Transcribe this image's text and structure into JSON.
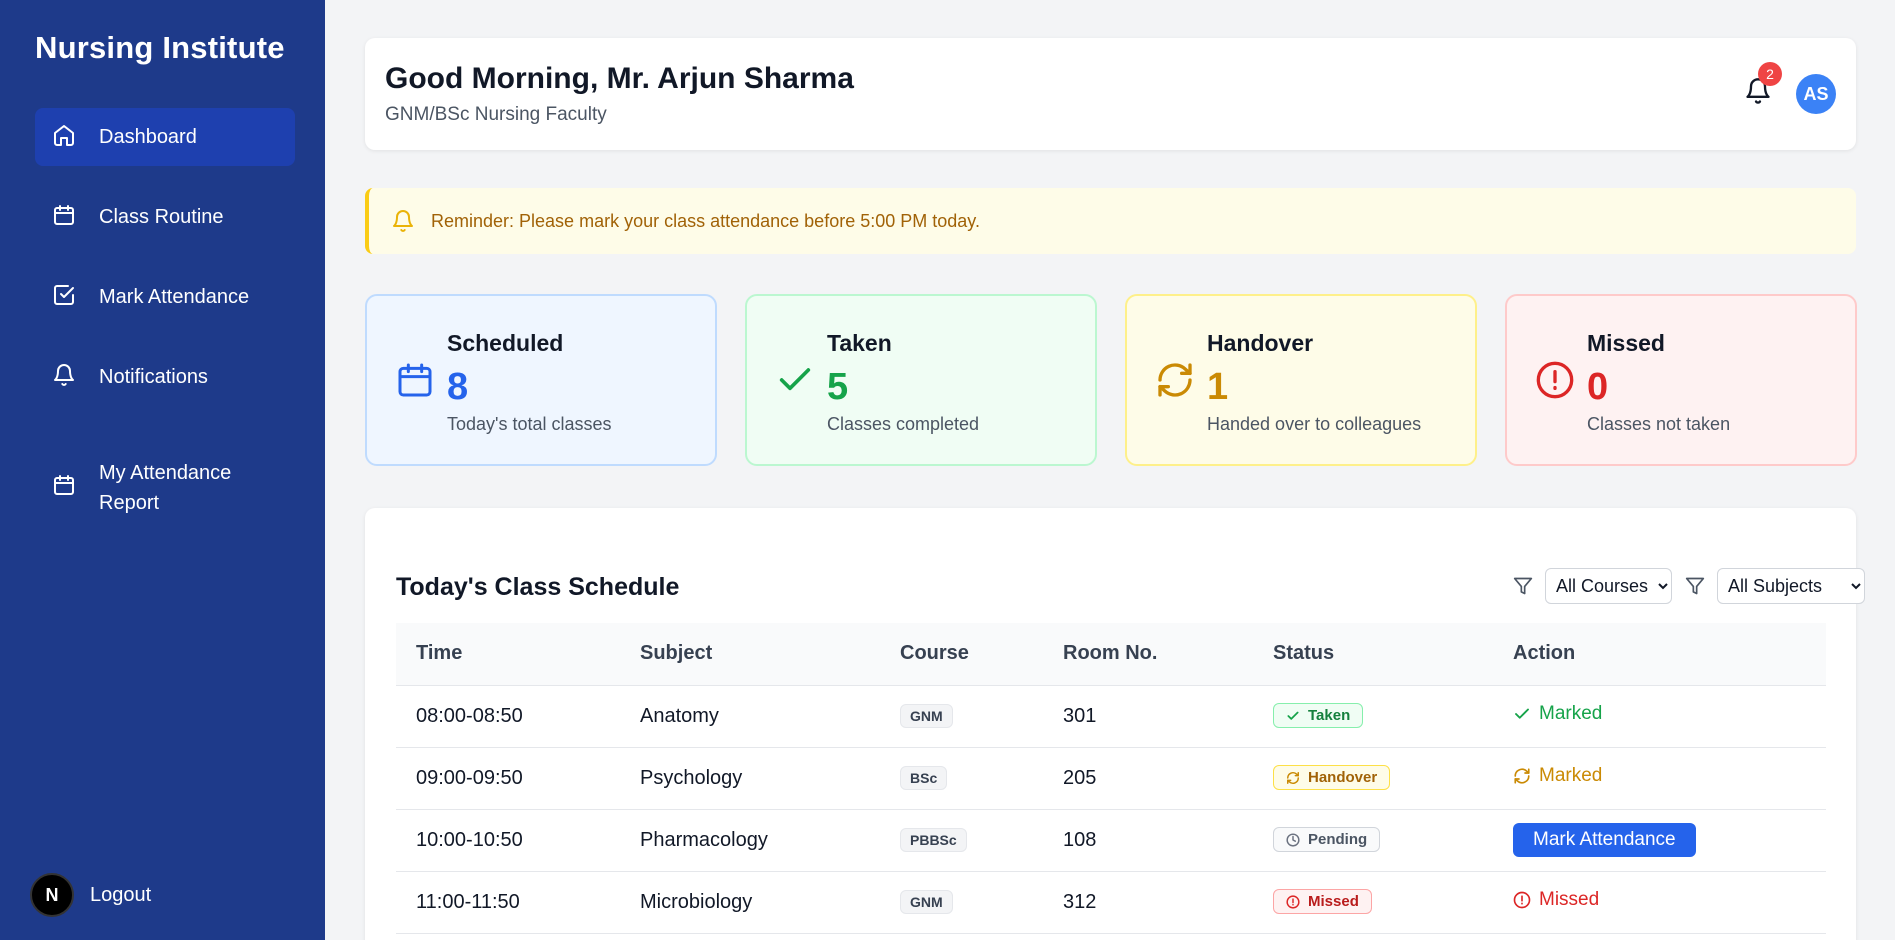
{
  "sidebar": {
    "brand": "Nursing Institute",
    "items": [
      {
        "label": "Dashboard",
        "icon": "home-icon"
      },
      {
        "label": "Class Routine",
        "icon": "calendar-icon"
      },
      {
        "label": "Mark Attendance",
        "icon": "check-square-icon"
      },
      {
        "label": "Notifications",
        "icon": "bell-icon"
      },
      {
        "label": "My Attendance Report",
        "icon": "calendar-icon"
      }
    ],
    "logout_label": "Logout",
    "logout_avatar": "N"
  },
  "header": {
    "greeting": "Good Morning, Mr. Arjun Sharma",
    "subtitle": "GNM/BSc Nursing Faculty",
    "notification_count": "2",
    "user_initials": "AS"
  },
  "reminder": {
    "text": "Reminder: Please mark your class attendance before 5:00 PM today."
  },
  "stats": [
    {
      "title": "Scheduled",
      "value": "8",
      "desc": "Today's total classes",
      "color": "#2563eb"
    },
    {
      "title": "Taken",
      "value": "5",
      "desc": "Classes completed",
      "color": "#16a34a"
    },
    {
      "title": "Handover",
      "value": "1",
      "desc": "Handed over to colleagues",
      "color": "#ca8a04"
    },
    {
      "title": "Missed",
      "value": "0",
      "desc": "Classes not taken",
      "color": "#dc2626"
    }
  ],
  "schedule": {
    "title": "Today's Class Schedule",
    "course_filter": "All Courses",
    "subject_filter": "All Subjects",
    "columns": [
      "Time",
      "Subject",
      "Course",
      "Room No.",
      "Status",
      "Action"
    ],
    "rows": [
      {
        "time": "08:00-08:50",
        "subject": "Anatomy",
        "course": "GNM",
        "room": "301",
        "status": "Taken",
        "action": "Marked"
      },
      {
        "time": "09:00-09:50",
        "subject": "Psychology",
        "course": "BSc",
        "room": "205",
        "status": "Handover",
        "action": "Marked"
      },
      {
        "time": "10:00-10:50",
        "subject": "Pharmacology",
        "course": "PBBSc",
        "room": "108",
        "status": "Pending",
        "action": "Mark Attendance"
      },
      {
        "time": "11:00-11:50",
        "subject": "Microbiology",
        "course": "GNM",
        "room": "312",
        "status": "Missed",
        "action": "Missed"
      }
    ]
  }
}
